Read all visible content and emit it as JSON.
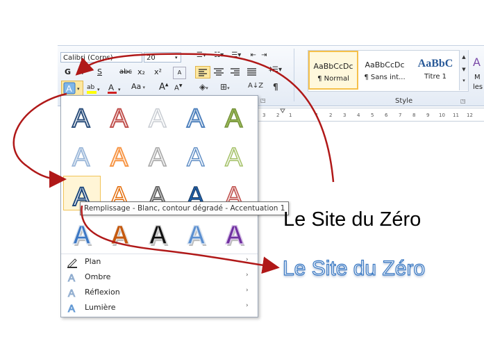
{
  "font": {
    "name": "Calibri (Corps)",
    "size": "20"
  },
  "format_buttons": {
    "bold": "G",
    "italic": "I",
    "underline": "S",
    "strike": "abc",
    "subscript": "x₂",
    "superscript": "x²",
    "case": "Aa"
  },
  "styles": {
    "group_label": "Style",
    "items": [
      {
        "sample": "AaBbCcDc",
        "name": "¶ Normal"
      },
      {
        "sample": "AaBbCcDc",
        "name": "¶ Sans int..."
      },
      {
        "sample": "AaBbC",
        "name": "Titre 1"
      }
    ],
    "partial": "M",
    "partial2": "les"
  },
  "tooltip": "Remplissage - Blanc, contour dégradé - Accentuation 1",
  "menu": [
    {
      "label": "Plan",
      "icon": "pen-outline-icon",
      "arrow": "›"
    },
    {
      "label": "Ombre",
      "icon": "shadow-a-icon",
      "arrow": "›"
    },
    {
      "label": "Réflexion",
      "icon": "reflection-a-icon",
      "arrow": "›"
    },
    {
      "label": "Lumière",
      "icon": "glow-a-icon",
      "arrow": "›"
    }
  ],
  "document": {
    "plain_text": "Le Site du Zéro",
    "styled_text": "Le Site du Zéro"
  },
  "gallery_letter": "A",
  "colors": {
    "arrow": "#b01818",
    "accent": "#3a78c2",
    "hover": "#f1c256"
  }
}
